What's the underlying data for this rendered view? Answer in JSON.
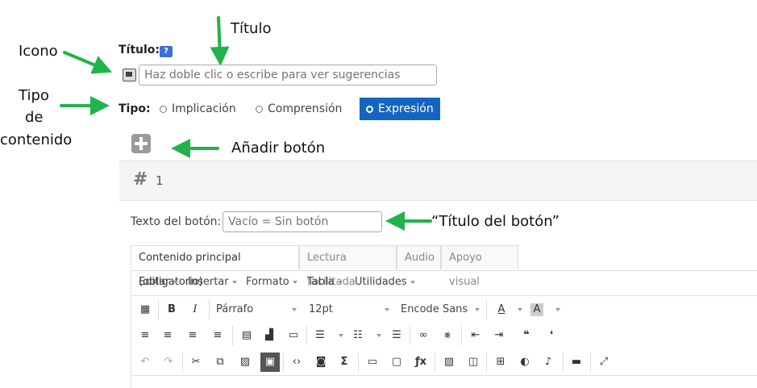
{
  "annotations": {
    "icono": "Icono",
    "titulo": "Título",
    "tipo": [
      "Tipo",
      "de",
      "contenido"
    ],
    "anadir": "Añadir botón",
    "titulo_boton": "“Título del botón”"
  },
  "form": {
    "titulo_label": "Título:",
    "help_icon": "?",
    "titulo_placeholder": "Haz doble clic o escribe para ver sugerencias",
    "tipo_label": "Tipo:",
    "tipo_options": [
      "Implicación",
      "Comprensión",
      "Expresión"
    ],
    "tipo_selected": "Expresión",
    "item_number": "1",
    "hash": "#",
    "texto_boton_label": "Texto del botón:",
    "texto_boton_placeholder": "Vacío = Sin botón"
  },
  "editor": {
    "tabs": [
      "Contenido principal (obligatorio)",
      "Lectura facilitada",
      "Audio",
      "Apoyo visual"
    ],
    "active_tab": "Contenido principal (obligatorio)",
    "menus": [
      "Editar",
      "Insertar",
      "Formato",
      "Tabla",
      "Utilidades"
    ],
    "block_format": "Párrafo",
    "font_size": "12pt",
    "font_family": "Encode Sans"
  },
  "colors": {
    "accent": "#1565c0",
    "arrow": "#22b24c"
  }
}
